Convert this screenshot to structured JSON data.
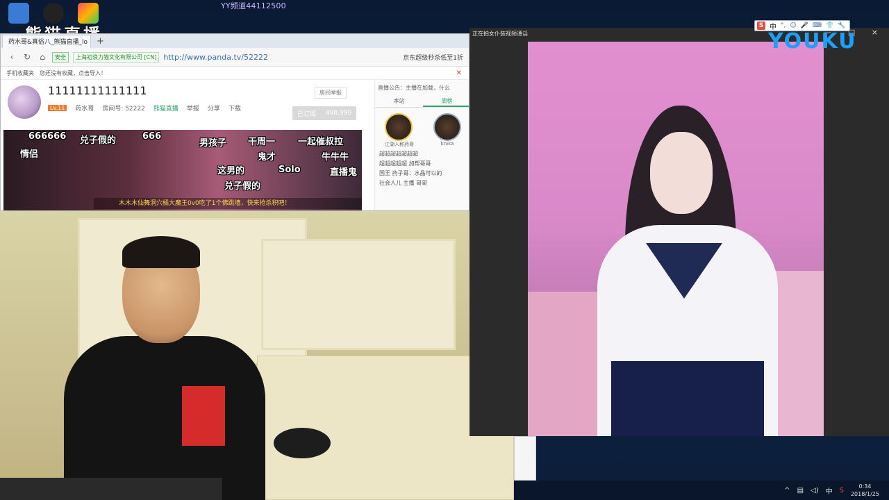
{
  "overlay": {
    "channel_label": "YY频道44112500",
    "stream_logo": "熊猫直播"
  },
  "browser": {
    "tab_title": "药水哥&真俗八_熊猫直播_lo",
    "tab_close": "×",
    "new_tab": "+",
    "security_badge": "安全",
    "cert_label": "上海初浪力猫文化有限公司 [CN]",
    "url": "http://www.panda.tv/52222",
    "right_link": "京东超级秒杀低至1折",
    "bookmarks": [
      "手机收藏夹",
      "您还没有收藏，点击导入！"
    ]
  },
  "room": {
    "title": "11111111111111",
    "level": "Lv.11",
    "host_name": "药水哥",
    "room_id": "房间号: 52222",
    "btn_follow_label": "熊猫直播",
    "btn_report": "举报",
    "btn_share": "分享",
    "btn_download": "下载",
    "subscribe_label": "已订阅",
    "subscribe_count": "498,990",
    "report_label": "房间举报"
  },
  "danmu": [
    {
      "text": "666666"
    },
    {
      "text": "兑子假的"
    },
    {
      "text": "666"
    },
    {
      "text": "男孩子"
    },
    {
      "text": "干周一"
    },
    {
      "text": "一起催叔拉"
    },
    {
      "text": "情侣"
    },
    {
      "text": "鬼才"
    },
    {
      "text": "牛牛牛"
    },
    {
      "text": "Solo"
    },
    {
      "text": "直播鬼"
    },
    {
      "text": "这男的"
    },
    {
      "text": "兑子假的"
    }
  ],
  "announcement": "木木木仙舞洞穴橘大魔王0v0吃了1个佛跳墙，快来抢杀积吧！",
  "side": {
    "notice": "直播公告：主播在加载，什么",
    "tabs": [
      "本站",
      "周榜"
    ],
    "top_fans": [
      "江湖人称药哥",
      "knika"
    ],
    "lines": [
      "超超超超超超超",
      "超超超超超 加帮哥哥",
      "国王 药子哥：水晶可以的",
      "社会人儿 主播 哥哥"
    ]
  },
  "video_window": {
    "title": "正在拍女仆装视频通话",
    "brand": "YOUKU",
    "controls": "— □ ×"
  },
  "ime": {
    "s_logo": "S",
    "lang": "中",
    "icons": [
      "°,",
      "☺",
      "🎤",
      "⌨",
      "👕",
      "🔧"
    ]
  },
  "taskbar": {
    "ime_label": "中",
    "time": "0:34",
    "date": "2018/1/25"
  }
}
